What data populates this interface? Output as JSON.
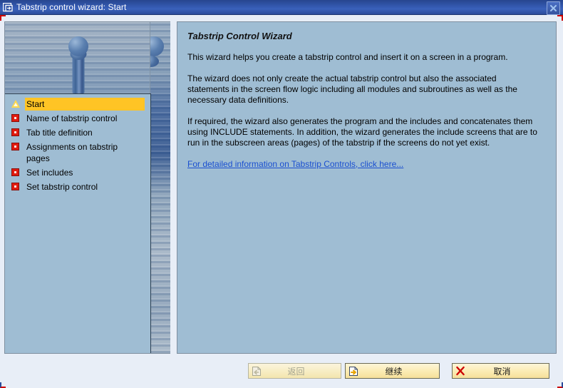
{
  "window": {
    "title": "Tabstrip control wizard: Start",
    "icon": "session-window-icon",
    "close_label": "×"
  },
  "sidebar": {
    "banner_icon": "water-droplet-banner",
    "steps": [
      {
        "label": "Start",
        "icon": "yellow-triangle-icon",
        "active": true
      },
      {
        "label": "Name of tabstrip control",
        "icon": "red-square-icon",
        "active": false
      },
      {
        "label": "Tab title definition",
        "icon": "red-square-icon",
        "active": false
      },
      {
        "label": "Assignments on tabstrip pages",
        "icon": "red-square-icon",
        "active": false
      },
      {
        "label": "Set includes",
        "icon": "red-square-icon",
        "active": false
      },
      {
        "label": "Set tabstrip control",
        "icon": "red-square-icon",
        "active": false
      }
    ]
  },
  "content": {
    "title": "Tabstrip Control Wizard",
    "paragraph1": "This wizard helps you create a tabstrip control and insert it on a screen in a program.",
    "paragraph2": "The wizard does not only create the actual tabstrip control but also the associated statements in the screen flow logic including all modules and subroutines as well as the necessary data definitions.",
    "paragraph3": "If required, the wizard also generates the program and the includes and concatenates them using INCLUDE statements. In addition, the wizard generates the include screens that are to run in the subscreen areas (pages) of the tabstrip if the screens do not yet exist.",
    "link": "For detailed information on Tabstrip Controls, click here..."
  },
  "footer": {
    "back": {
      "label": "返回",
      "icon": "page-back-arrow-icon",
      "enabled": false
    },
    "next": {
      "label": "继续",
      "icon": "page-forward-arrow-icon",
      "enabled": true
    },
    "cancel": {
      "label": "取消",
      "icon": "red-x-icon",
      "enabled": true
    }
  },
  "colors": {
    "titlebar": "#2e51a3",
    "panel_bg": "#9fbdd3",
    "highlight": "#ffc425",
    "link": "#1a4fd0",
    "button_bg": "#fbecb4",
    "marker_red": "#cc0000"
  }
}
